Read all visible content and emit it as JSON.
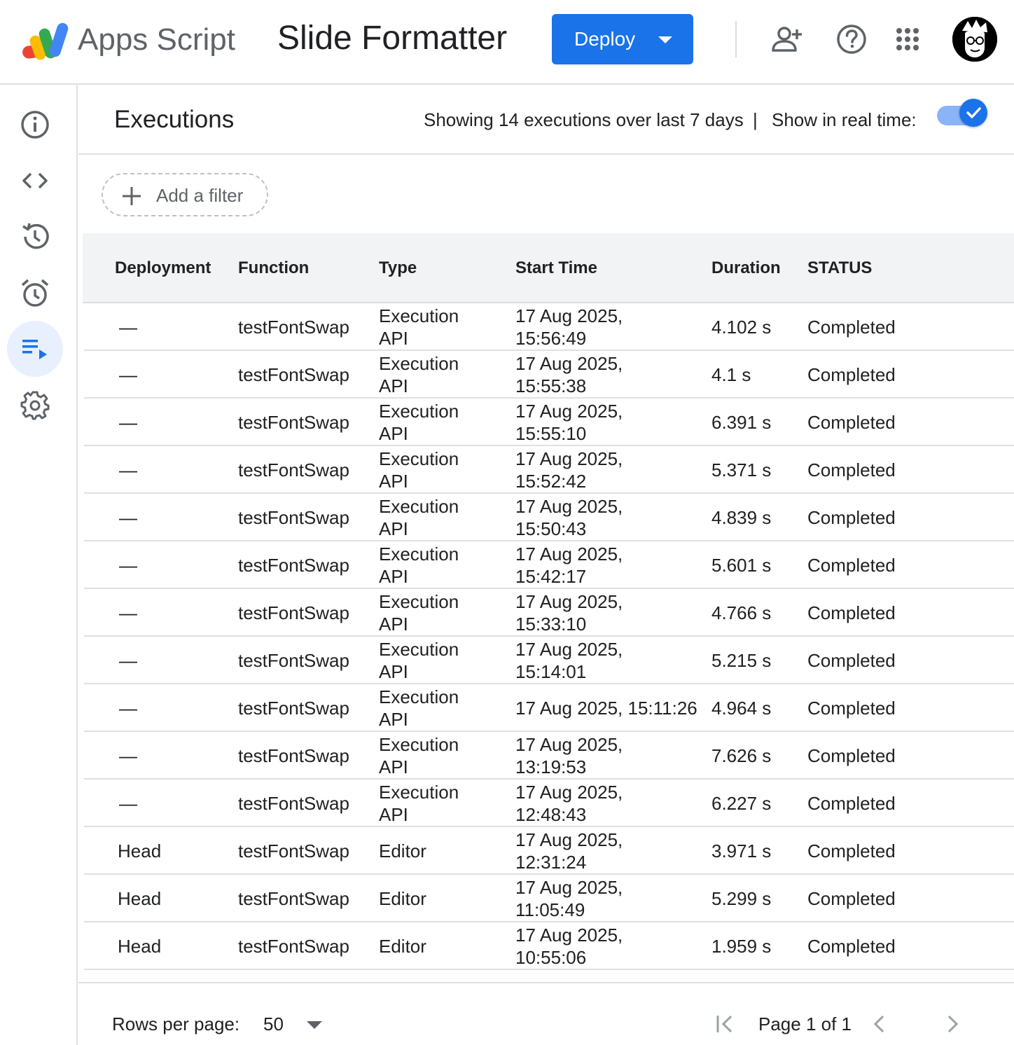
{
  "app": {
    "name": "Apps Script",
    "project_title": "Slide Formatter"
  },
  "toolbar": {
    "deploy_label": "Deploy"
  },
  "icons": {
    "share": "add-person-icon",
    "help": "help-icon",
    "apps": "apps-grid-icon",
    "avatar": "avatar"
  },
  "sidebar": {
    "items": [
      {
        "name": "overview",
        "icon": "info-icon"
      },
      {
        "name": "editor",
        "icon": "code-icon"
      },
      {
        "name": "project-history",
        "icon": "history-icon"
      },
      {
        "name": "triggers",
        "icon": "alarm-icon"
      },
      {
        "name": "executions",
        "icon": "executions-icon",
        "active": true
      },
      {
        "name": "settings",
        "icon": "gear-icon"
      }
    ]
  },
  "executions": {
    "title": "Executions",
    "summary": "Showing 14 executions over last 7 days",
    "separator": "|",
    "realtime_label": "Show in real time:",
    "realtime_enabled": true
  },
  "filter": {
    "label": "Add a filter"
  },
  "table": {
    "columns": [
      "Deployment",
      "Function",
      "Type",
      "Start Time",
      "Duration",
      "STATUS"
    ],
    "rows": [
      {
        "deployment": "—",
        "function": "testFontSwap",
        "type": [
          "Execution",
          "API"
        ],
        "start": [
          "17 Aug 2025,",
          "15:56:49"
        ],
        "duration": "4.102 s",
        "status": "Completed"
      },
      {
        "deployment": "—",
        "function": "testFontSwap",
        "type": [
          "Execution",
          "API"
        ],
        "start": [
          "17 Aug 2025,",
          "15:55:38"
        ],
        "duration": "4.1 s",
        "status": "Completed"
      },
      {
        "deployment": "—",
        "function": "testFontSwap",
        "type": [
          "Execution",
          "API"
        ],
        "start": [
          "17 Aug 2025,",
          "15:55:10"
        ],
        "duration": "6.391 s",
        "status": "Completed"
      },
      {
        "deployment": "—",
        "function": "testFontSwap",
        "type": [
          "Execution",
          "API"
        ],
        "start": [
          "17 Aug 2025,",
          "15:52:42"
        ],
        "duration": "5.371 s",
        "status": "Completed"
      },
      {
        "deployment": "—",
        "function": "testFontSwap",
        "type": [
          "Execution",
          "API"
        ],
        "start": [
          "17 Aug 2025,",
          "15:50:43"
        ],
        "duration": "4.839 s",
        "status": "Completed"
      },
      {
        "deployment": "—",
        "function": "testFontSwap",
        "type": [
          "Execution",
          "API"
        ],
        "start": [
          "17 Aug 2025,",
          "15:42:17"
        ],
        "duration": "5.601 s",
        "status": "Completed"
      },
      {
        "deployment": "—",
        "function": "testFontSwap",
        "type": [
          "Execution",
          "API"
        ],
        "start": [
          "17 Aug 2025,",
          "15:33:10"
        ],
        "duration": "4.766 s",
        "status": "Completed"
      },
      {
        "deployment": "—",
        "function": "testFontSwap",
        "type": [
          "Execution",
          "API"
        ],
        "start": [
          "17 Aug 2025,",
          "15:14:01"
        ],
        "duration": "5.215 s",
        "status": "Completed"
      },
      {
        "deployment": "—",
        "function": "testFontSwap",
        "type": [
          "Execution",
          "API"
        ],
        "start": [
          "17 Aug 2025, 15:11:26"
        ],
        "duration": "4.964 s",
        "status": "Completed"
      },
      {
        "deployment": "—",
        "function": "testFontSwap",
        "type": [
          "Execution",
          "API"
        ],
        "start": [
          "17 Aug 2025,",
          "13:19:53"
        ],
        "duration": "7.626 s",
        "status": "Completed"
      },
      {
        "deployment": "—",
        "function": "testFontSwap",
        "type": [
          "Execution",
          "API"
        ],
        "start": [
          "17 Aug 2025,",
          "12:48:43"
        ],
        "duration": "6.227 s",
        "status": "Completed"
      },
      {
        "deployment": "Head",
        "function": "testFontSwap",
        "type": [
          "Editor"
        ],
        "start": [
          "17 Aug 2025,",
          "12:31:24"
        ],
        "duration": "3.971 s",
        "status": "Completed"
      },
      {
        "deployment": "Head",
        "function": "testFontSwap",
        "type": [
          "Editor"
        ],
        "start": [
          "17 Aug 2025,",
          "11:05:49"
        ],
        "duration": "5.299 s",
        "status": "Completed"
      },
      {
        "deployment": "Head",
        "function": "testFontSwap",
        "type": [
          "Editor"
        ],
        "start": [
          "17 Aug 2025,",
          "10:55:06"
        ],
        "duration": "1.959 s",
        "status": "Completed"
      }
    ]
  },
  "pagination": {
    "rows_per_page_label": "Rows per page:",
    "rows_per_page": "50",
    "page_label": "Page 1 of 1"
  },
  "colors": {
    "primary": "#1a73e8",
    "toggle_track": "#8ab4f8",
    "active_nav_bg": "#e8f0fe",
    "header_bg": "#f1f3f4"
  }
}
